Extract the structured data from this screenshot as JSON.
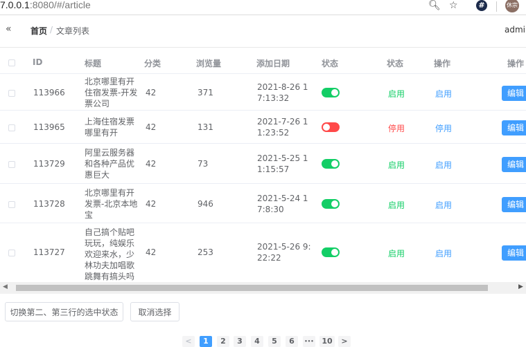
{
  "browser": {
    "url_host": "7.0.0.1",
    "url_rest": ":8080/#/article",
    "profile_label": "休宗"
  },
  "header": {
    "fold_icon": "«",
    "breadcrumb_home": "首页",
    "breadcrumb_sep": "/",
    "breadcrumb_current": "文章列表",
    "user": "admin"
  },
  "table": {
    "columns": [
      "ID",
      "标题",
      "分类",
      "浏览量",
      "添加日期",
      "状态",
      "状态",
      "操作",
      "操作"
    ],
    "rows": [
      {
        "id": "113966",
        "title": "北京哪里有开住宿发票-开发票公司",
        "category": "42",
        "views": "371",
        "date": "2021-8-26 17:13:32",
        "enabled": true,
        "status": "启用",
        "action": "启用",
        "edit": "编辑"
      },
      {
        "id": "113965",
        "title": "上海住宿发票哪里有开",
        "category": "42",
        "views": "131",
        "date": "2021-7-26 11:23:52",
        "enabled": false,
        "status": "停用",
        "action": "停用",
        "edit": "编辑"
      },
      {
        "id": "113729",
        "title": "阿里云服务器和各种产品优惠巨大",
        "category": "42",
        "views": "73",
        "date": "2021-5-25 11:15:57",
        "enabled": true,
        "status": "启用",
        "action": "启用",
        "edit": "编辑"
      },
      {
        "id": "113728",
        "title": "北京哪里有开发票-北京本地宝",
        "category": "42",
        "views": "946",
        "date": "2021-5-24 17:8:30",
        "enabled": true,
        "status": "启用",
        "action": "启用",
        "edit": "编辑"
      },
      {
        "id": "113727",
        "title": "自己搞个贴吧玩玩，纯娱乐欢迎来水，少林功夫加唱歌跳舞有搞头吗",
        "category": "42",
        "views": "253",
        "date": "2021-5-26 9:22:22",
        "enabled": true,
        "status": "启用",
        "action": "启用",
        "edit": "编辑"
      }
    ]
  },
  "buttons": {
    "toggle_selection": "切换第二、第三行的选中状态",
    "clear_selection": "取消选择"
  },
  "pagination": {
    "prev": "<",
    "pages": [
      "1",
      "2",
      "3",
      "4",
      "5",
      "6",
      "•••",
      "10"
    ],
    "current": "1",
    "next": ">"
  },
  "colors": {
    "primary": "#409eff",
    "switch_on": "#13ce66",
    "switch_off": "#ff4949"
  }
}
